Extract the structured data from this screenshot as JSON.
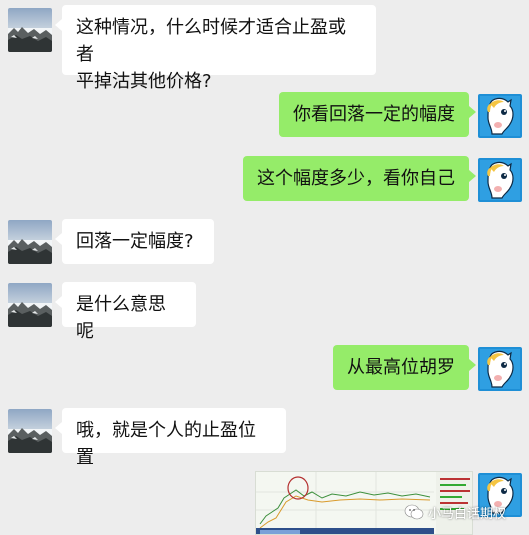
{
  "chat": {
    "messages": [
      {
        "side": "left",
        "text": "这种情况，什么时候才适合止盈或者\n平掉沽其他价格?"
      },
      {
        "side": "right",
        "text": "你看回落一定的幅度"
      },
      {
        "side": "right",
        "text": "这个幅度多少，看你自己"
      },
      {
        "side": "left",
        "text": "回落一定幅度?"
      },
      {
        "side": "left",
        "text": "是什么意思呢"
      },
      {
        "side": "right",
        "text": "从最高位胡罗"
      },
      {
        "side": "left",
        "text": "哦，就是个人的止盈位置"
      }
    ]
  },
  "watermark": {
    "text": "小马白话期权",
    "icon": "wechat-icon"
  },
  "colors": {
    "background": "#ededed",
    "incoming_bubble": "#ffffff",
    "outgoing_bubble": "#95ec69"
  }
}
